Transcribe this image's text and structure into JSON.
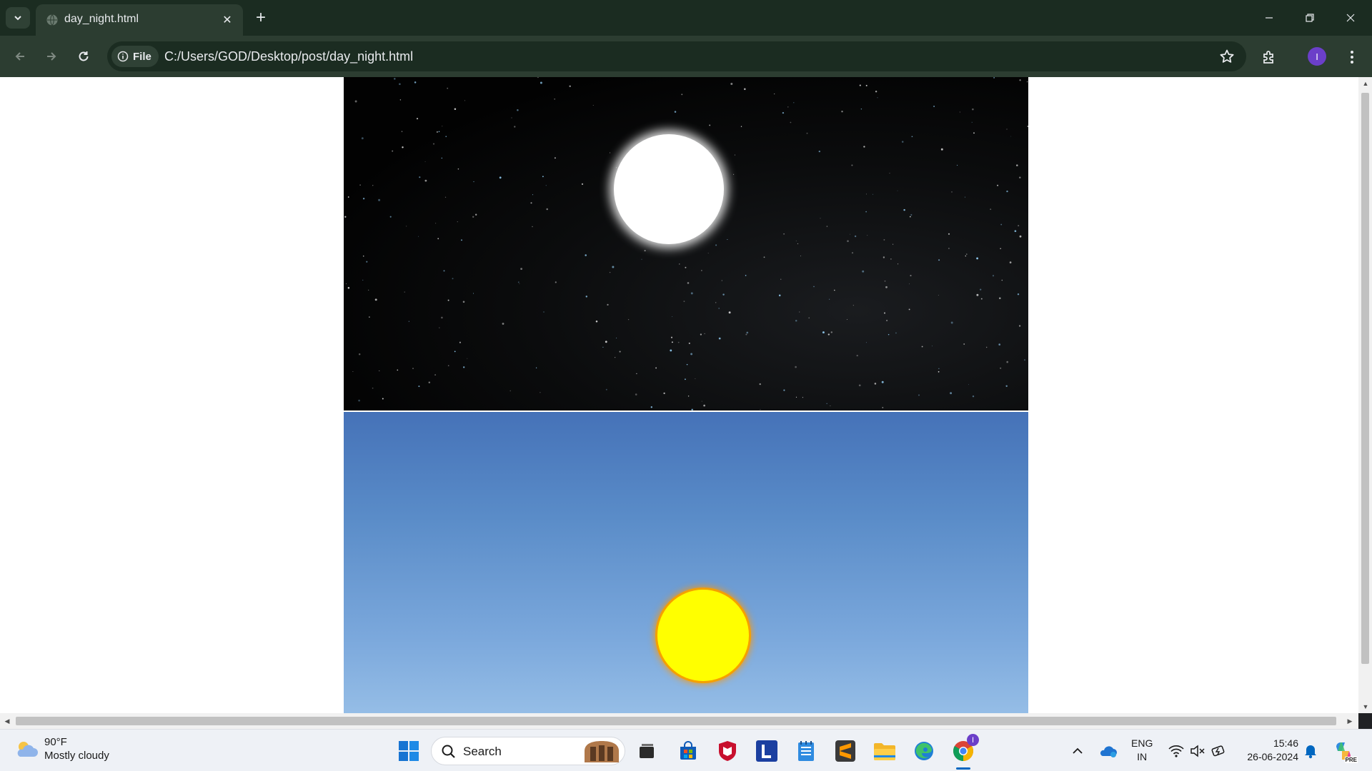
{
  "browser": {
    "tab": {
      "title": "day_night.html",
      "icon": "globe-icon"
    },
    "address_bar": {
      "chip_label": "File",
      "url": "C:/Users/GOD/Desktop/post/day_night.html"
    },
    "profile_initial": "I",
    "window_controls": [
      "minimize-icon",
      "restore-icon",
      "close-icon"
    ]
  },
  "page": {
    "panels": [
      {
        "name": "night-sky",
        "orb": "moon",
        "background": "#000000",
        "orb_color": "#ffffff"
      },
      {
        "name": "day-sky",
        "orb": "sun",
        "background": "#4a7dc4",
        "orb_color": "#ffff00",
        "orb_glow": "#f5a000"
      }
    ]
  },
  "taskbar": {
    "weather": {
      "temp": "90°F",
      "desc": "Mostly cloudy",
      "icon": "cloud-icon"
    },
    "search_label": "Search",
    "pinned_apps": [
      "start-icon",
      "search-icon",
      "task-view-icon",
      "store-icon",
      "mcafee-icon",
      "l-app-icon",
      "notepad-icon",
      "sublime-icon",
      "file-explorer-icon",
      "edge-icon",
      "chrome-icon"
    ],
    "chrome_badge": "I",
    "tray": {
      "lang_top": "ENG",
      "lang_bottom": "IN",
      "time": "15:46",
      "date": "26-06-2024"
    }
  }
}
